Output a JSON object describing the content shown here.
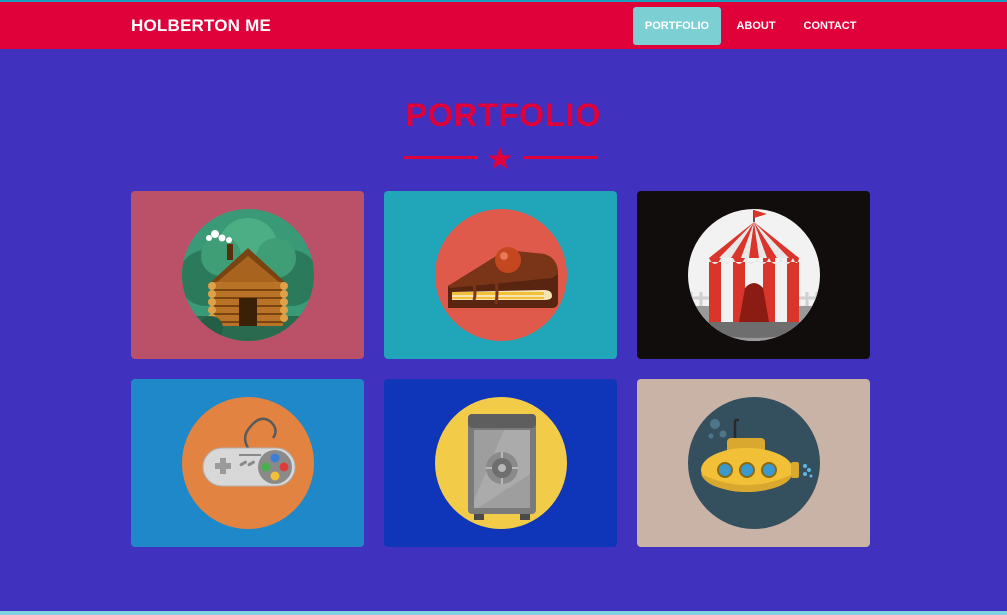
{
  "brand": "HOLBERTON ME",
  "nav": {
    "items": [
      {
        "label": "PORTFOLIO",
        "active": true
      },
      {
        "label": "ABOUT",
        "active": false
      },
      {
        "label": "CONTACT",
        "active": false
      }
    ]
  },
  "section": {
    "title": "PORTFOLIO",
    "divider_icon": "star-icon"
  },
  "portfolio": {
    "items": [
      {
        "icon": "log-cabin-icon",
        "bg": "#bb5069",
        "circle": "#3a9a78"
      },
      {
        "icon": "cake-slice-icon",
        "bg": "#20a6b8",
        "circle": "#e05a4b"
      },
      {
        "icon": "circus-tent-icon",
        "bg": "#120d0d",
        "circle": "#f2f2f2"
      },
      {
        "icon": "game-controller-icon",
        "bg": "#1f88c8",
        "circle": "#e38342"
      },
      {
        "icon": "safe-icon",
        "bg": "#0f35b8",
        "circle": "#f2cc48"
      },
      {
        "icon": "submarine-icon",
        "bg": "#c9b3a6",
        "circle": "#34505e"
      }
    ]
  },
  "colors": {
    "background": "#4131bf",
    "navbar": "#e0003a",
    "active_nav": "#7ccfd3",
    "accent": "#e0003a"
  }
}
